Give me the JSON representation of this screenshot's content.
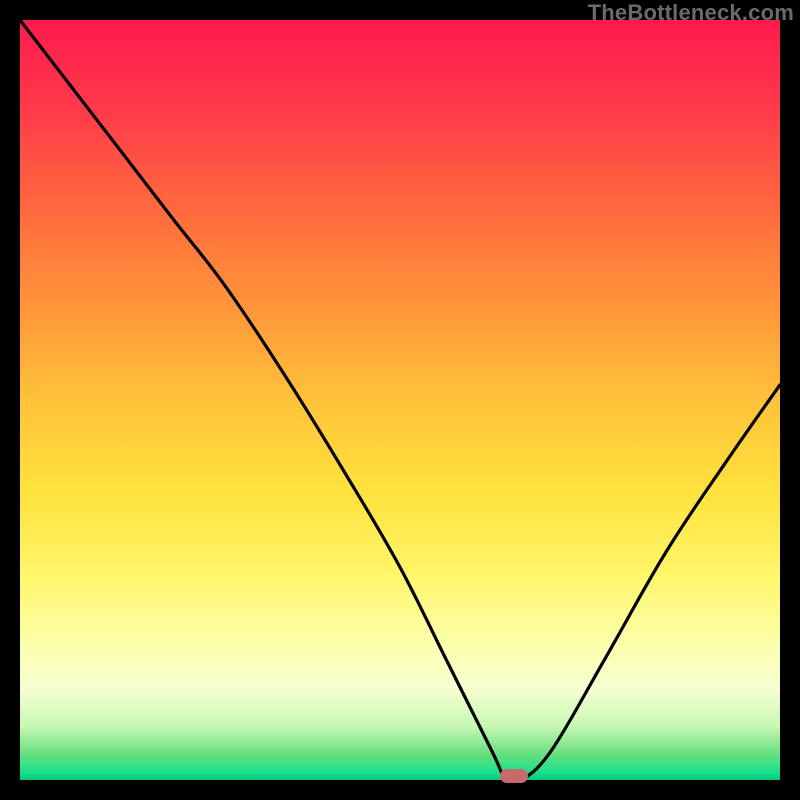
{
  "watermark": "TheBottleneck.com",
  "chart_data": {
    "type": "line",
    "title": "",
    "xlabel": "",
    "ylabel": "",
    "xlim": [
      0,
      100
    ],
    "ylim": [
      0,
      100
    ],
    "grid": false,
    "legend": false,
    "series": [
      {
        "name": "bottleneck-curve",
        "x": [
          0,
          10,
          20,
          27,
          35,
          43,
          50,
          56,
          62,
          64,
          66,
          70,
          77,
          85,
          93,
          100
        ],
        "values": [
          100,
          87,
          74,
          65,
          53,
          40,
          28,
          16,
          4,
          0,
          0,
          4,
          16,
          30,
          42,
          52
        ]
      }
    ],
    "marker": {
      "x": 65,
      "y": 0,
      "color": "#c76a6a"
    },
    "gradient_stops": [
      {
        "pos": 0.0,
        "color": "#ff1a4d"
      },
      {
        "pos": 0.25,
        "color": "#ff6a3d"
      },
      {
        "pos": 0.5,
        "color": "#ffc23a"
      },
      {
        "pos": 0.73,
        "color": "#fff66a"
      },
      {
        "pos": 0.93,
        "color": "#c6f7b3"
      },
      {
        "pos": 1.0,
        "color": "#00c97a"
      }
    ]
  }
}
